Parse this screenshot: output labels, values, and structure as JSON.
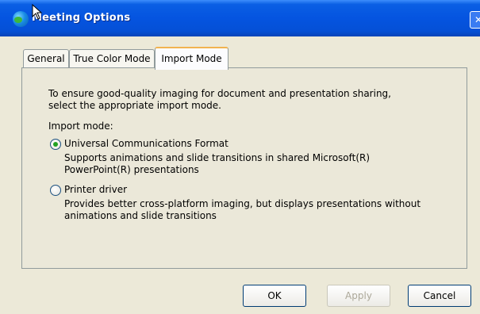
{
  "window": {
    "title": "Meeting Options"
  },
  "tabs": [
    {
      "label": "General"
    },
    {
      "label": "True Color Mode"
    },
    {
      "label": "Import Mode"
    }
  ],
  "active_tab": "Import Mode",
  "import_mode": {
    "intro_line1": "To ensure good-quality imaging for document and presentation sharing,",
    "intro_line2": "select the appropriate import mode.",
    "group_label": "Import mode:",
    "options": [
      {
        "label": "Universal Communications Format",
        "checked": true,
        "desc_line1": "Supports animations and slide transitions in shared Microsoft(R)",
        "desc_line2": "PowerPoint(R) presentations"
      },
      {
        "label": "Printer driver",
        "checked": false,
        "desc_line1": "Provides better cross-platform imaging, but displays presentations without",
        "desc_line2": "animations and slide transitions"
      }
    ]
  },
  "buttons": {
    "ok": "OK",
    "apply": "Apply",
    "cancel": "Cancel"
  },
  "colors": {
    "titlebar": "#0554e0",
    "dialog_bg": "#ece9d8",
    "tab_highlight": "#f1b34f",
    "radio_dot": "#21a121"
  },
  "icons": {
    "app": "globe-icon",
    "close": "close-icon",
    "cursor": "mouse-cursor-icon"
  }
}
